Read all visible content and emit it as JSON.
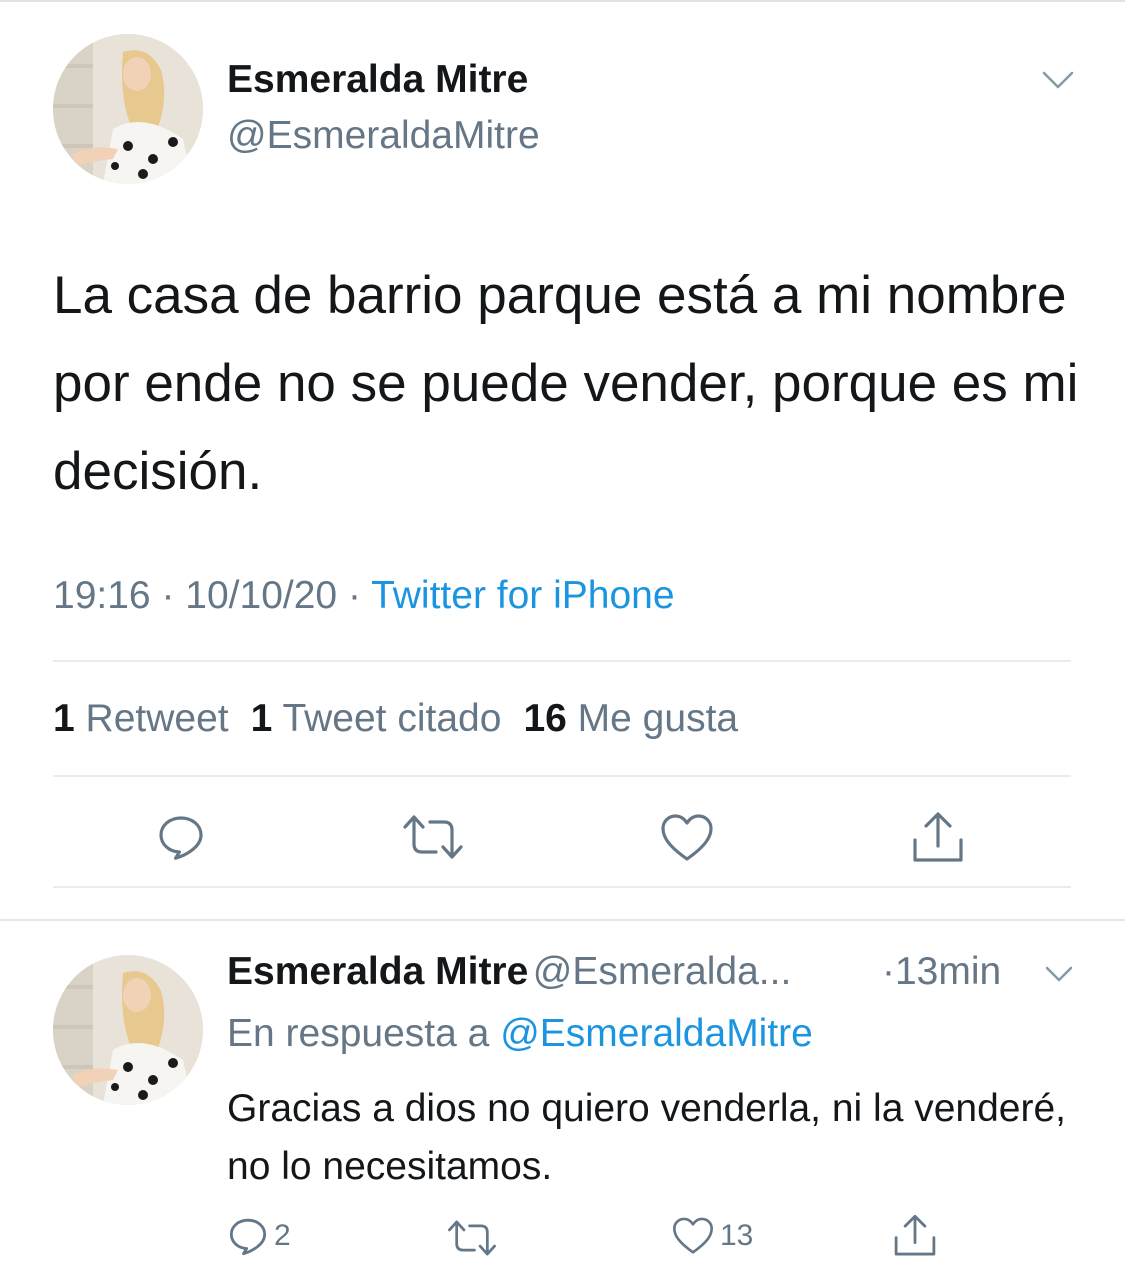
{
  "main_tweet": {
    "author_name": "Esmeralda Mitre",
    "author_handle": "@EsmeraldaMitre",
    "text": "La casa de barrio parque está a mi nombre por ende no se puede vender, porque es mi decisión.",
    "time": "19:16",
    "date": "10/10/20",
    "separator": "·",
    "source": "Twitter for iPhone",
    "stats": {
      "retweets_count": "1",
      "retweets_label": "Retweet",
      "quotes_count": "1",
      "quotes_label": "Tweet citado",
      "likes_count": "16",
      "likes_label": "Me gusta"
    },
    "actions": [
      "reply-icon",
      "retweet-icon",
      "like-icon",
      "share-icon"
    ],
    "menu_icon": "chevron-down-icon"
  },
  "reply_tweet": {
    "author_name": "Esmeralda Mitre",
    "author_handle": "@Esmeralda...",
    "time": "·13min",
    "reply_prefix": "En respuesta a",
    "reply_mention": "@EsmeraldaMitre",
    "text": "Gracias a dios no quiero venderla, ni la venderé, no lo necesitamos.",
    "reply_count": "2",
    "like_count": "13",
    "actions": [
      "reply-icon",
      "retweet-icon",
      "like-icon",
      "share-icon"
    ],
    "menu_icon": "chevron-down-icon"
  },
  "colors": {
    "text": "#14171a",
    "secondary": "#657786",
    "link": "#1b95e0",
    "divider": "#e6ecf0",
    "icon": "#657786"
  }
}
